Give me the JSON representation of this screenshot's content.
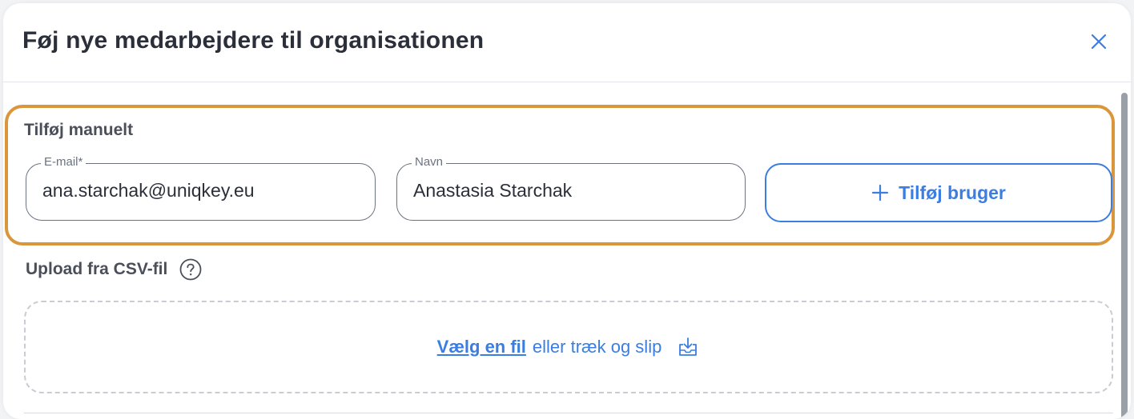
{
  "dialog": {
    "title": "Føj nye medarbejdere til organisationen",
    "close_icon": "close-icon"
  },
  "manual": {
    "label": "Tilføj manuelt",
    "email": {
      "legend": "E-mail*",
      "value": "ana.starchak@uniqkey.eu"
    },
    "name": {
      "legend": "Navn",
      "value": "Anastasia Starchak"
    },
    "add_button_label": "Tilføj bruger",
    "add_icon": "plus-icon"
  },
  "csv": {
    "label": "Upload fra CSV-fil",
    "help_icon": "question-circle-icon",
    "choose_link": "Vælg en fil",
    "drop_text": "eller træk og slip",
    "upload_icon": "upload-icon"
  },
  "colors": {
    "accent": "#3b7de0",
    "highlight": "#d9963a",
    "text": "#2b2f3a"
  }
}
